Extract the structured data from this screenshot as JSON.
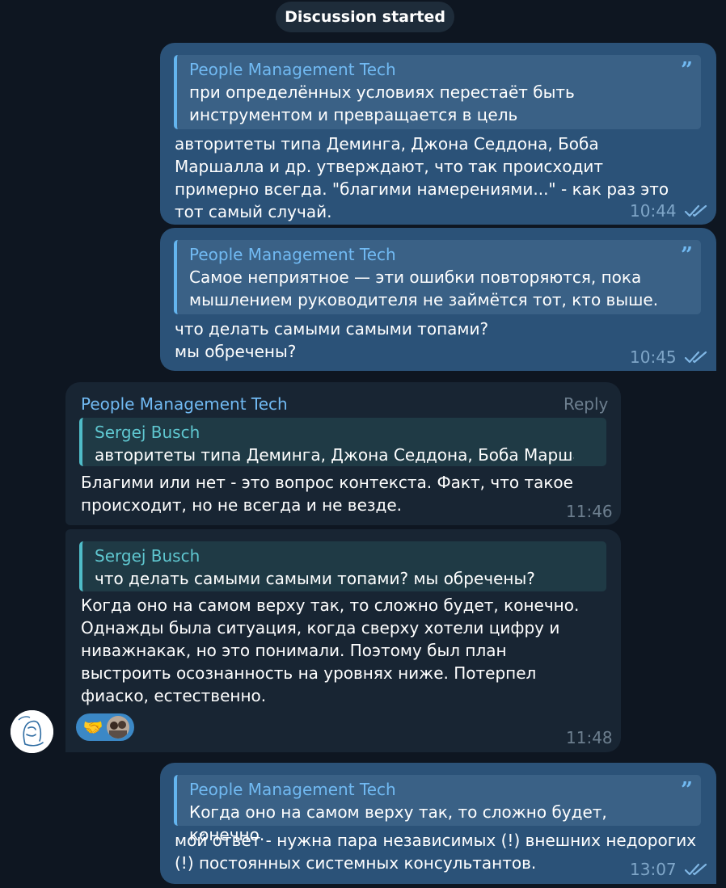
{
  "divider": {
    "label": "Discussion started"
  },
  "messages": [
    {
      "quote_name": "People Management Tech",
      "quote_text": "при определённых условиях перестаёт быть инструментом и превращается в цель",
      "text": "авторитеты типа Деминга, Джона Седдона, Боба Маршалла и др. утверждают, что так происходит примерно всегда. \"благими намерениями...\" - как раз это тот самый случай.",
      "time": "10:44"
    },
    {
      "quote_name": "People Management Tech",
      "quote_text": "Самое неприятное — эти ошибки повторяются, пока мышлением руководителя не займётся тот, кто выше.",
      "text": "что делать самыми самыми топами?\nмы обречены?",
      "time": "10:45"
    },
    {
      "sender": "People Management Tech",
      "reply_label": "Reply",
      "quote_name": "Sergej Busch",
      "quote_text": "авторитеты типа Деминга, Джона Седдона, Боба Маршалл...",
      "text": "Благими или нет - это вопрос контекста. Факт, что такое происходит, но не всегда и не везде.",
      "time": "11:46"
    },
    {
      "quote_name": "Sergej Busch",
      "quote_text": "что делать самыми самыми топами? мы обречены?",
      "text": "Когда оно на самом верху так, то сложно будет, конечно. Однажды была ситуация, когда сверху хотели цифру и ниважнакак, но это понимали. Поэтому был план выстроить осознанность на уровнях ниже. Потерпел фиаско, естественно.",
      "time": "11:48",
      "reaction_emoji": "🤝"
    },
    {
      "quote_name": "People Management Tech",
      "quote_text": "Когда оно на самом верху так, то сложно будет, конечно.",
      "text": "мой ответ - нужна пара независимых (!) внешних недорогих (!) постоянных системных консультантов.",
      "time": "13:07"
    }
  ],
  "colors": {
    "background": "#0e1621",
    "outgoing_bubble": "#2b5278",
    "incoming_bubble": "#182533",
    "accent_blue": "#71baf3",
    "accent_teal": "#5fc7d0"
  },
  "icons": {
    "quote": "quote-icon",
    "read_status": "double-check-icon",
    "avatar": "profile-avatar",
    "reaction_avatar": "reactor-avatar"
  }
}
